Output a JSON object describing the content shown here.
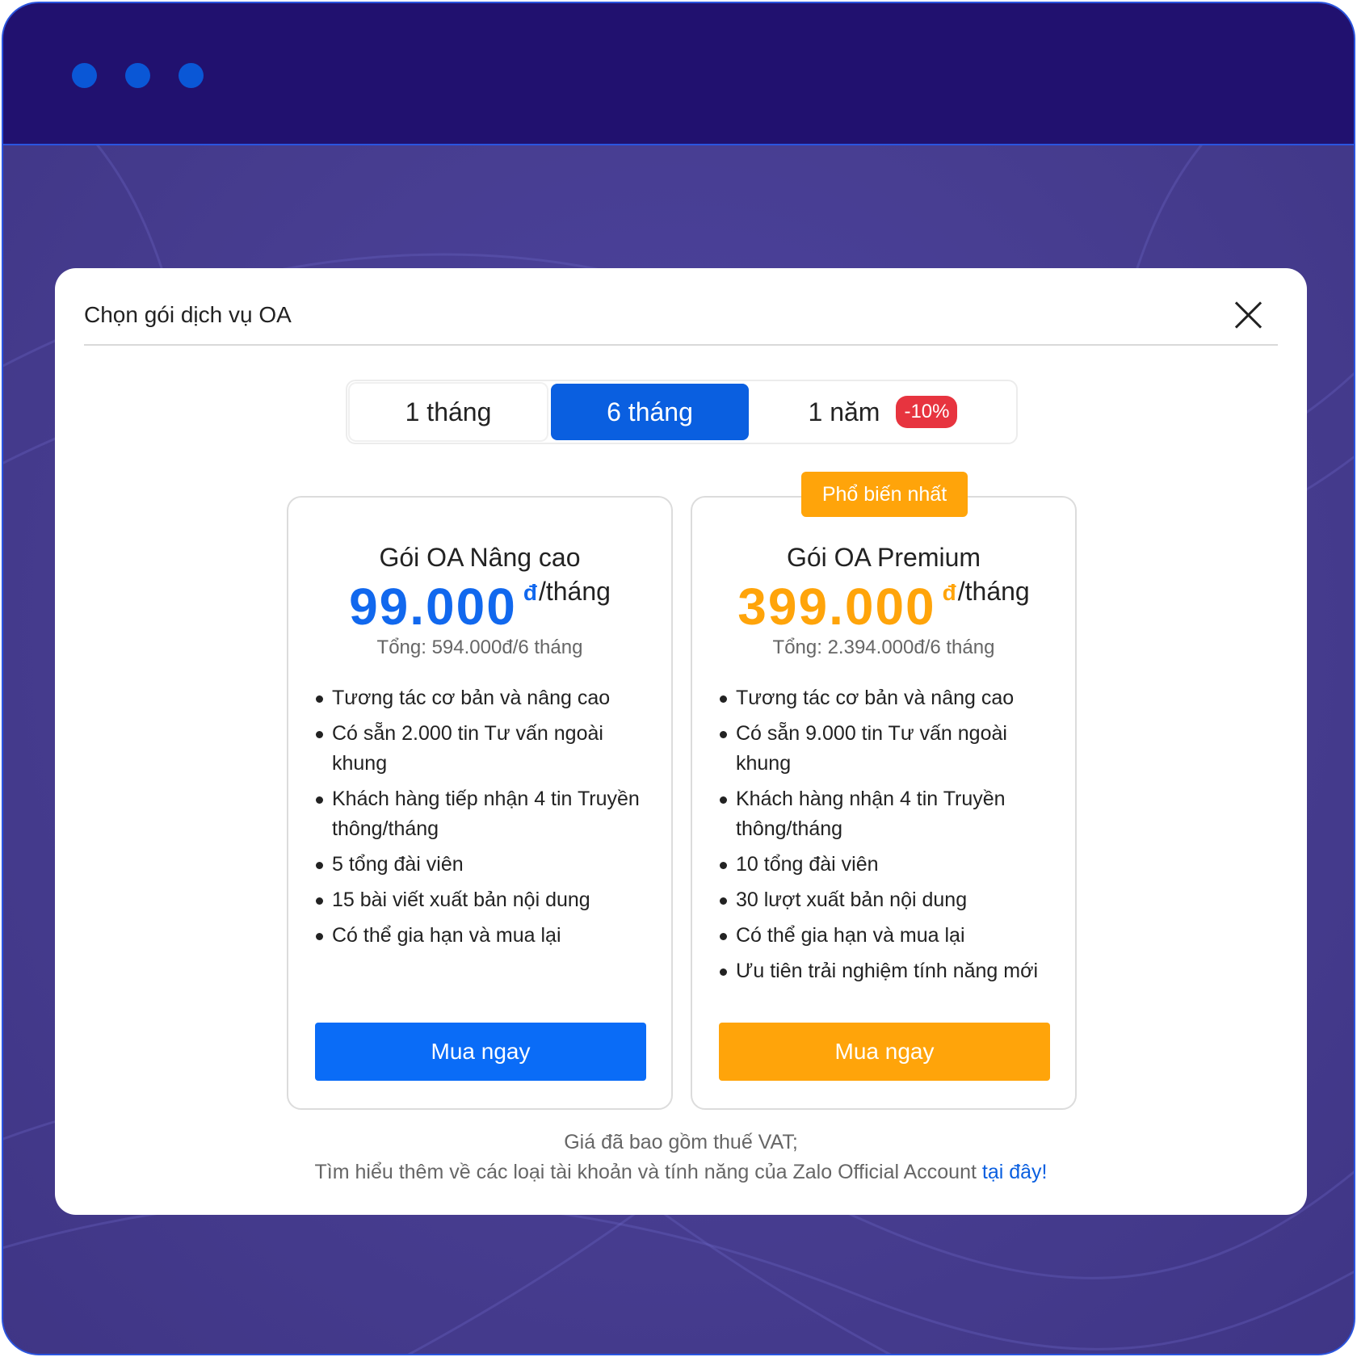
{
  "modal": {
    "title": "Chọn gói dịch vụ OA"
  },
  "tabs": [
    {
      "label": "1 tháng",
      "active": false
    },
    {
      "label": "6 tháng",
      "active": true
    },
    {
      "label": "1 năm",
      "badge": "-10%",
      "active": false
    }
  ],
  "plans": [
    {
      "name": "Gói OA Nâng cao",
      "price": "99.000",
      "currency": "đ",
      "per": "/tháng",
      "total": "Tổng: 594.000đ/6 tháng",
      "features": [
        "Tương tác cơ bản và nâng cao",
        "Có sẵn 2.000 tin Tư vấn ngoài khung",
        "Khách hàng tiếp nhận 4 tin Truyền thông/tháng",
        "5 tổng đài viên",
        "15 bài viết xuất bản nội dung",
        "Có thể gia hạn và mua lại"
      ],
      "button": "Mua ngay",
      "accent": "#1168ee"
    },
    {
      "badge": "Phổ biến nhất",
      "name": "Gói OA Premium",
      "price": "399.000",
      "currency": "đ",
      "per": "/tháng",
      "total": "Tổng: 2.394.000đ/6 tháng",
      "features": [
        "Tương tác cơ bản và nâng cao",
        "Có sẵn 9.000 tin Tư vấn ngoài khung",
        "Khách hàng nhận 4 tin Truyền thông/tháng",
        "10 tổng đài viên",
        "30 lượt xuất bản nội dung",
        "Có thể gia hạn và mua lại",
        "Ưu tiên trải nghiệm tính năng mới"
      ],
      "button": "Mua ngay",
      "accent": "#ffa40a"
    }
  ],
  "footer": {
    "line1": "Giá đã bao gồm thuế VAT;",
    "line2": "Tìm hiểu thêm về các loại tài khoản và tính năng của Zalo Official Account ",
    "link": "tại đây!"
  },
  "colors": {
    "titlebar": "#21116f",
    "primary": "#0a5fe0",
    "orange": "#ffa40a",
    "discount": "#e7343f"
  },
  "icons": {
    "close": "close-icon"
  }
}
